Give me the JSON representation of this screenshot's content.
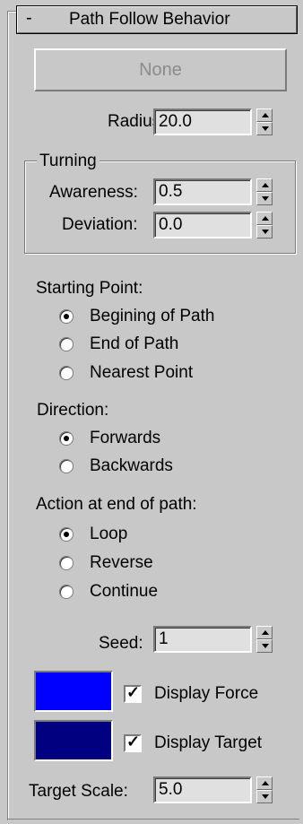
{
  "rollout": {
    "collapse_symbol": "-",
    "title": "Path Follow Behavior"
  },
  "path_button": {
    "label": "None"
  },
  "radius": {
    "label": "Radius:",
    "value": "20.0"
  },
  "turning": {
    "group_label": "Turning",
    "awareness": {
      "label": "Awareness:",
      "value": "0.5"
    },
    "deviation": {
      "label": "Deviation:",
      "value": "0.0"
    }
  },
  "starting_point": {
    "label": "Starting Point:",
    "options": [
      {
        "label": "Begining of Path",
        "checked": true
      },
      {
        "label": "End of Path",
        "checked": false
      },
      {
        "label": "Nearest Point",
        "checked": false
      }
    ]
  },
  "direction": {
    "label": "Direction:",
    "options": [
      {
        "label": "Forwards",
        "checked": true
      },
      {
        "label": "Backwards",
        "checked": false
      }
    ]
  },
  "end_action": {
    "label": "Action at end of path:",
    "options": [
      {
        "label": "Loop",
        "checked": true
      },
      {
        "label": "Reverse",
        "checked": false
      },
      {
        "label": "Continue",
        "checked": false
      }
    ]
  },
  "seed": {
    "label": "Seed:",
    "value": "1"
  },
  "display_force": {
    "label": "Display Force",
    "checked": true,
    "color": "#0000ff"
  },
  "display_target": {
    "label": "Display Target",
    "checked": true,
    "color": "#000080"
  },
  "target_scale": {
    "label": "Target Scale:",
    "value": "5.0"
  },
  "icons": {
    "spinner": "spinner-arrows-icon"
  }
}
